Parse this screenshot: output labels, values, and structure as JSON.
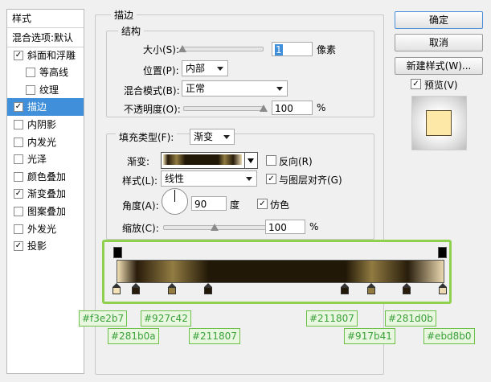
{
  "left_list": {
    "header": "样式",
    "items": [
      {
        "label": "混合选项:默认",
        "checkbox": false,
        "checked": false,
        "indent": 0,
        "selected": false
      },
      {
        "label": "斜面和浮雕",
        "checkbox": true,
        "checked": true,
        "indent": 0,
        "selected": false
      },
      {
        "label": "等高线",
        "checkbox": true,
        "checked": false,
        "indent": 1,
        "selected": false
      },
      {
        "label": "纹理",
        "checkbox": true,
        "checked": false,
        "indent": 1,
        "selected": false
      },
      {
        "label": "描边",
        "checkbox": true,
        "checked": true,
        "indent": 0,
        "selected": true
      },
      {
        "label": "内阴影",
        "checkbox": true,
        "checked": false,
        "indent": 0,
        "selected": false
      },
      {
        "label": "内发光",
        "checkbox": true,
        "checked": false,
        "indent": 0,
        "selected": false
      },
      {
        "label": "光泽",
        "checkbox": true,
        "checked": false,
        "indent": 0,
        "selected": false
      },
      {
        "label": "颜色叠加",
        "checkbox": true,
        "checked": false,
        "indent": 0,
        "selected": false
      },
      {
        "label": "渐变叠加",
        "checkbox": true,
        "checked": true,
        "indent": 0,
        "selected": false
      },
      {
        "label": "图案叠加",
        "checkbox": true,
        "checked": false,
        "indent": 0,
        "selected": false
      },
      {
        "label": "外发光",
        "checkbox": true,
        "checked": false,
        "indent": 0,
        "selected": false
      },
      {
        "label": "投影",
        "checkbox": true,
        "checked": true,
        "indent": 0,
        "selected": false
      }
    ],
    "check_mark": "✓"
  },
  "stroke": {
    "title": "描边",
    "structure_title": "结构",
    "size_label": "大小(S):",
    "size_value": "1",
    "size_unit": "像素",
    "position_label": "位置(P):",
    "position_value": "内部",
    "blend_label": "混合模式(B):",
    "blend_value": "正常",
    "opacity_label": "不透明度(O):",
    "opacity_value": "100",
    "opacity_unit": "%",
    "fill_type_label": "填充类型(F):",
    "fill_type_value": "渐变",
    "gradient_label": "渐变:",
    "reverse_label": "反向(R)",
    "reverse_checked": false,
    "style_label": "样式(L):",
    "style_value": "线性",
    "align_label": "与图层对齐(G)",
    "align_checked": true,
    "angle_label": "角度(A):",
    "angle_value": "90",
    "angle_unit": "度",
    "dither_label": "仿色",
    "dither_checked": true,
    "scale_label": "缩放(C):",
    "scale_value": "100",
    "scale_unit": "%",
    "size_fraction": 0.01,
    "opacity_fraction": 1.0,
    "scale_fraction": 0.5
  },
  "buttons": {
    "ok": "确定",
    "cancel": "取消",
    "new_style": "新建样式(W)...",
    "preview_label": "预览(V)",
    "preview_checked": true
  },
  "gradient_stops": [
    {
      "color": "#f3e2b7",
      "pos": 0.0
    },
    {
      "color": "#281b0a",
      "pos": 0.06
    },
    {
      "color": "#927c42",
      "pos": 0.17
    },
    {
      "color": "#211807",
      "pos": 0.28
    },
    {
      "color": "#211807",
      "pos": 0.7
    },
    {
      "color": "#917b41",
      "pos": 0.78
    },
    {
      "color": "#281d0b",
      "pos": 0.89
    },
    {
      "color": "#ebd8b0",
      "pos": 1.0
    }
  ],
  "color_tags": {
    "t1": "#f3e2b7",
    "t2": "#281b0a",
    "t3": "#927c42",
    "t4": "#211807",
    "t5": "#211807",
    "t6": "#917b41",
    "t7": "#281d0b",
    "t8": "#ebd8b0"
  },
  "colors": {
    "selection_blue": "#3f8fdb",
    "highlight_green": "#8fd14f",
    "preview_swatch": "#fde8a8"
  }
}
